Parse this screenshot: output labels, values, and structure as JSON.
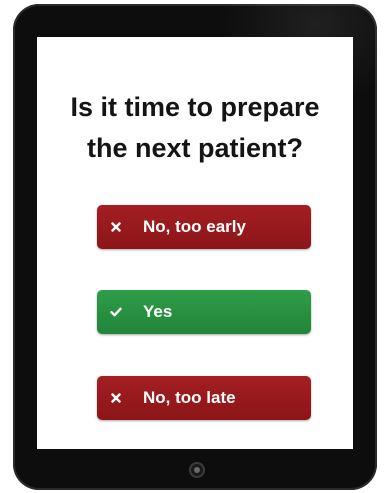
{
  "question": {
    "line1": "Is it time to prepare",
    "line2": "the next patient?"
  },
  "options": [
    {
      "label": "No, too early",
      "icon": "x-icon",
      "color": "#9b1b1e"
    },
    {
      "label": "Yes",
      "icon": "check-icon",
      "color": "#2a9443"
    },
    {
      "label": "No, too late",
      "icon": "x-icon",
      "color": "#9b1b1e"
    }
  ]
}
